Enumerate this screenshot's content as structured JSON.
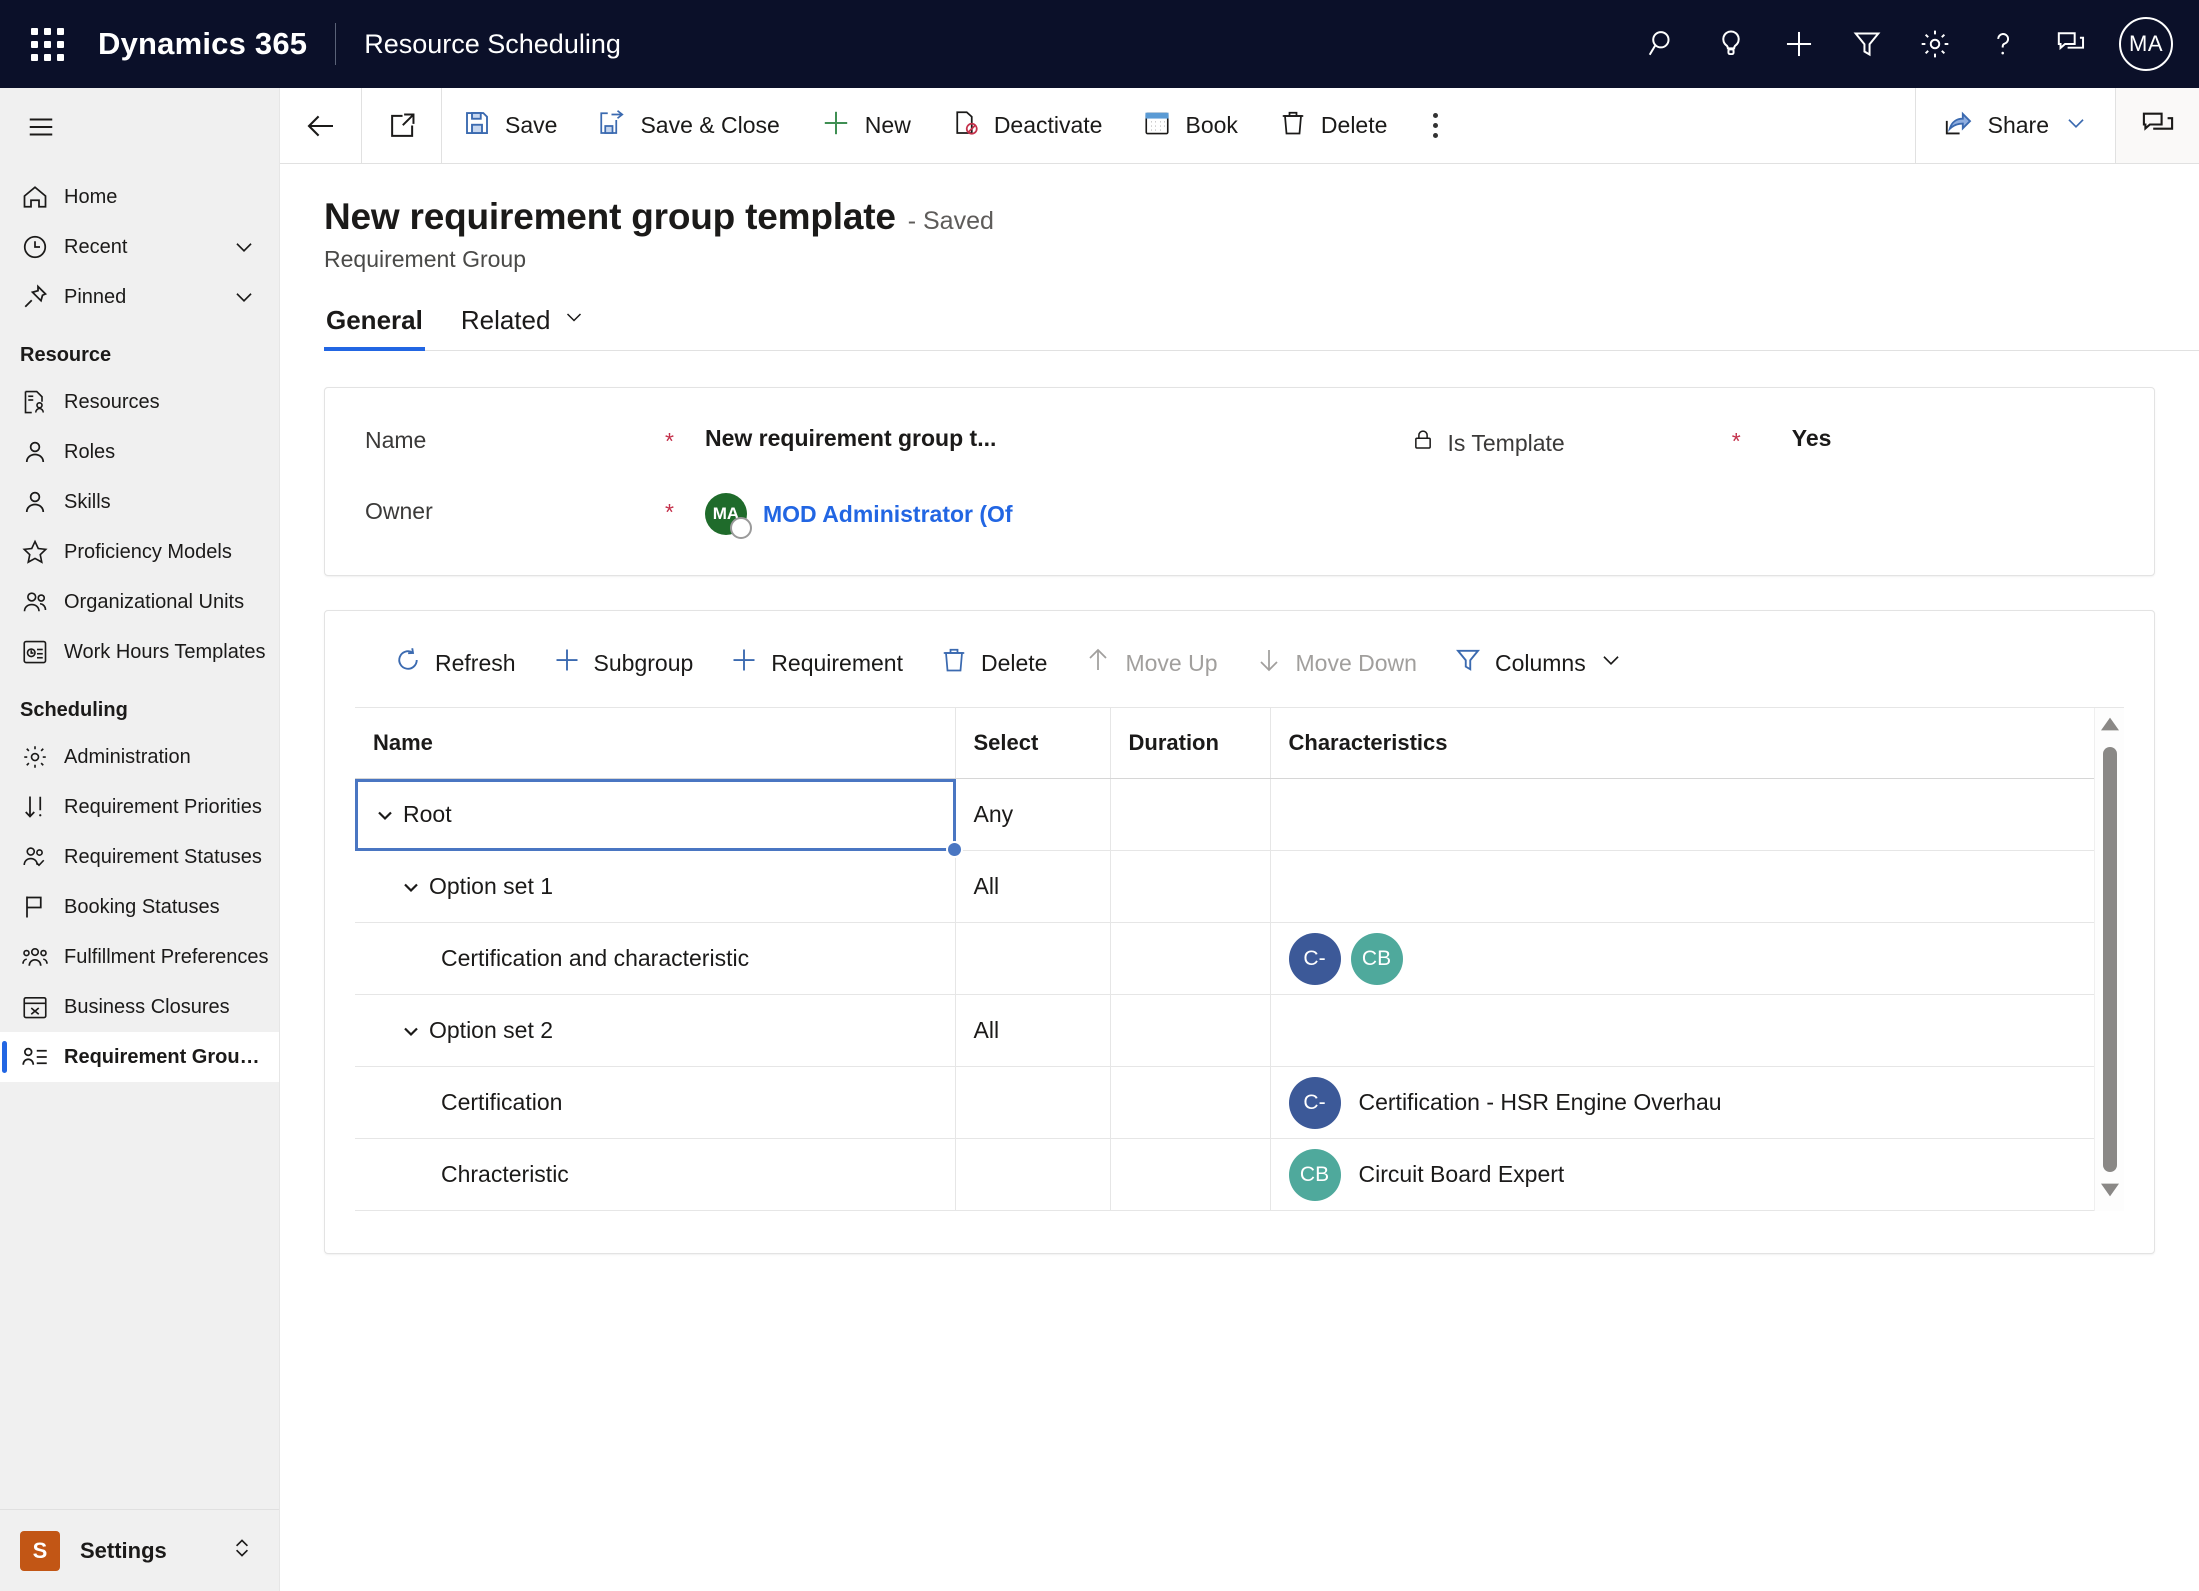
{
  "topbar": {
    "waffle_icon": "app-launcher-icon",
    "brand": "Dynamics 365",
    "app_name": "Resource Scheduling",
    "icons": [
      "search-icon",
      "lightbulb-icon",
      "plus-icon",
      "filter-icon",
      "gear-icon",
      "help-icon",
      "feedback-icon"
    ],
    "avatar_initials": "MA",
    "bg_color": "#0b1029"
  },
  "sidebar": {
    "hamburger_icon": "hamburger-menu-icon",
    "bg_color": "#f0f0f0",
    "top_items": [
      {
        "label": "Home",
        "icon": "home-icon",
        "chevron": false
      },
      {
        "label": "Recent",
        "icon": "clock-icon",
        "chevron": true
      },
      {
        "label": "Pinned",
        "icon": "pin-icon",
        "chevron": true
      }
    ],
    "groups": [
      {
        "title": "Resource",
        "items": [
          {
            "label": "Resources",
            "icon": "resource-card-icon"
          },
          {
            "label": "Roles",
            "icon": "person-icon"
          },
          {
            "label": "Skills",
            "icon": "person-icon"
          },
          {
            "label": "Proficiency Models",
            "icon": "star-icon"
          },
          {
            "label": "Organizational Units",
            "icon": "people-icon"
          },
          {
            "label": "Work Hours Templates",
            "icon": "clock-template-icon"
          }
        ]
      },
      {
        "title": "Scheduling",
        "items": [
          {
            "label": "Administration",
            "icon": "gear-icon"
          },
          {
            "label": "Requirement Priorities",
            "icon": "sort-priority-icon"
          },
          {
            "label": "Requirement Statuses",
            "icon": "people-check-icon"
          },
          {
            "label": "Booking Statuses",
            "icon": "flag-icon"
          },
          {
            "label": "Fulfillment Preferences",
            "icon": "people-group-icon"
          },
          {
            "label": "Business Closures",
            "icon": "calendar-x-icon"
          },
          {
            "label": "Requirement Group ...",
            "icon": "person-list-icon",
            "selected": true
          }
        ]
      }
    ],
    "settings": {
      "tile_letter": "S",
      "tile_color": "#c25615",
      "label": "Settings",
      "chevron_icon": "chevron-updown-icon"
    },
    "selected_indicator_color": "#2266e3"
  },
  "command_bar": {
    "back_icon": "back-arrow-icon",
    "popout_icon": "open-in-new-window-icon",
    "buttons": [
      {
        "label": "Save",
        "icon": "save-disk-icon"
      },
      {
        "label": "Save & Close",
        "icon": "save-and-close-icon"
      },
      {
        "label": "New",
        "icon": "plus-icon"
      },
      {
        "label": "Deactivate",
        "icon": "deactivate-icon"
      },
      {
        "label": "Book",
        "icon": "calendar-icon"
      },
      {
        "label": "Delete",
        "icon": "trash-icon"
      }
    ],
    "overflow_icon": "more-commands-icon",
    "share": {
      "label": "Share",
      "icon": "share-icon",
      "chevron_icon": "chevron-down-icon"
    },
    "chat_pane_icon": "chat-panel-icon"
  },
  "record": {
    "title": "New requirement group template",
    "saved_state": "- Saved",
    "entity": "Requirement Group",
    "tabs": [
      {
        "label": "General",
        "active": true,
        "chevron": false
      },
      {
        "label": "Related",
        "active": false,
        "chevron": true
      }
    ]
  },
  "form": {
    "required_mark": "*",
    "fields": {
      "name_label": "Name",
      "name_value": "New requirement group t...",
      "owner_label": "Owner",
      "owner_value": "MOD Administrator (Of",
      "owner_avatar_initials": "MA",
      "owner_avatar_color": "#1f6b2b",
      "owner_link_color": "#2266e3",
      "is_template_label": "Is Template",
      "is_template_icon": "lock-icon",
      "is_template_value": "Yes"
    }
  },
  "grid": {
    "toolbar": [
      {
        "label": "Refresh",
        "icon": "refresh-icon",
        "disabled": false
      },
      {
        "label": "Subgroup",
        "icon": "plus-icon",
        "disabled": false
      },
      {
        "label": "Requirement",
        "icon": "plus-icon",
        "disabled": false
      },
      {
        "label": "Delete",
        "icon": "trash-icon",
        "disabled": false
      },
      {
        "label": "Move Up",
        "icon": "arrow-up-icon",
        "disabled": true
      },
      {
        "label": "Move Down",
        "icon": "arrow-down-icon",
        "disabled": true
      },
      {
        "label": "Columns",
        "icon": "filter-icon",
        "disabled": false,
        "chevron": true
      }
    ],
    "columns": [
      "Name",
      "Select",
      "Duration",
      "Characteristics"
    ],
    "rows": [
      {
        "name": "Root",
        "indent": 0,
        "expander": true,
        "selected": true,
        "select": "Any",
        "duration": "",
        "chips": [],
        "chars_text": ""
      },
      {
        "name": "Option set 1",
        "indent": 1,
        "expander": true,
        "selected": false,
        "select": "All",
        "duration": "",
        "chips": [],
        "chars_text": ""
      },
      {
        "name": "Certification and characteristic",
        "indent": 2,
        "expander": false,
        "selected": false,
        "select": "",
        "duration": "",
        "chips": [
          {
            "initials": "C-",
            "color": "#3c5998"
          },
          {
            "initials": "CB",
            "color": "#4fa99c"
          }
        ],
        "chars_text": ""
      },
      {
        "name": "Option set 2",
        "indent": 1,
        "expander": true,
        "selected": false,
        "select": "All",
        "duration": "",
        "chips": [],
        "chars_text": ""
      },
      {
        "name": "Certification",
        "indent": 2,
        "expander": false,
        "selected": false,
        "select": "",
        "duration": "",
        "chips": [
          {
            "initials": "C-",
            "color": "#3c5998"
          }
        ],
        "chars_text": "Certification - HSR Engine Overhau"
      },
      {
        "name": "Chracteristic",
        "indent": 2,
        "expander": false,
        "selected": false,
        "select": "",
        "duration": "",
        "chips": [
          {
            "initials": "CB",
            "color": "#4fa99c"
          }
        ],
        "chars_text": "Circuit Board Expert"
      }
    ],
    "scrollbar": {
      "up_icon": "scroll-up-arrow-icon",
      "down_icon": "scroll-down-arrow-icon"
    }
  }
}
